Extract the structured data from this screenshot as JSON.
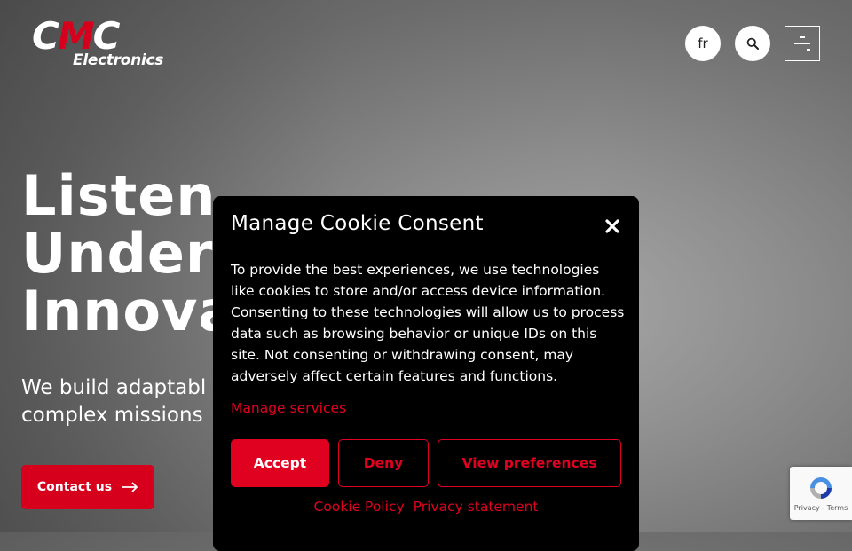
{
  "header": {
    "logo": {
      "top": "CMC",
      "bottom": "Electronics"
    },
    "lang_label": "fr",
    "search_icon": "search-icon",
    "menu_icon": "menu-icon"
  },
  "hero": {
    "title_lines": [
      "Listen",
      "Under",
      "Innova"
    ],
    "subtitle_lines": [
      "We build adaptabl",
      "complex missions"
    ],
    "cta_label": "Contact us",
    "cta_icon": "arrow-right-icon"
  },
  "cookie_modal": {
    "title": "Manage Cookie Consent",
    "close_icon": "close-icon",
    "body": "To provide the best experiences, we use technologies like cookies to store and/or access device information. Consenting to these technologies will allow us to process data such as browsing behavior or unique IDs on this site. Not consenting or withdrawing consent, may adversely affect certain features and functions.",
    "manage_services": "Manage services",
    "accept_label": "Accept",
    "deny_label": "Deny",
    "preferences_label": "View preferences",
    "cookie_policy": "Cookie Policy",
    "privacy_statement": "Privacy statement"
  },
  "recaptcha": {
    "terms": "Privacy - Terms"
  },
  "colors": {
    "brand_red": "#e0001f",
    "modal_bg": "#000000"
  }
}
